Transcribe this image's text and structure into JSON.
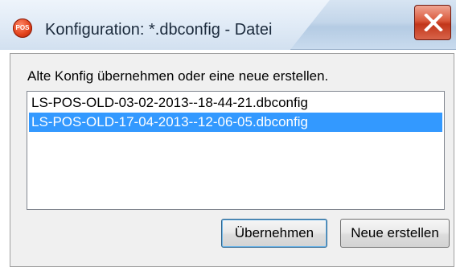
{
  "window": {
    "title": "Konfiguration: *.dbconfig - Datei",
    "app_icon_text": "POS"
  },
  "dialog": {
    "prompt": "Alte Konfig übernehmen oder eine neue erstellen.",
    "configs": [
      {
        "label": "LS-POS-OLD-03-02-2013--18-44-21.dbconfig",
        "selected": false
      },
      {
        "label": "LS-POS-OLD-17-04-2013--12-06-05.dbconfig",
        "selected": true
      }
    ],
    "buttons": {
      "accept": "Übernehmen",
      "create_new": "Neue erstellen"
    }
  },
  "colors": {
    "selection": "#3399ff",
    "close_button": "#c2361a"
  }
}
